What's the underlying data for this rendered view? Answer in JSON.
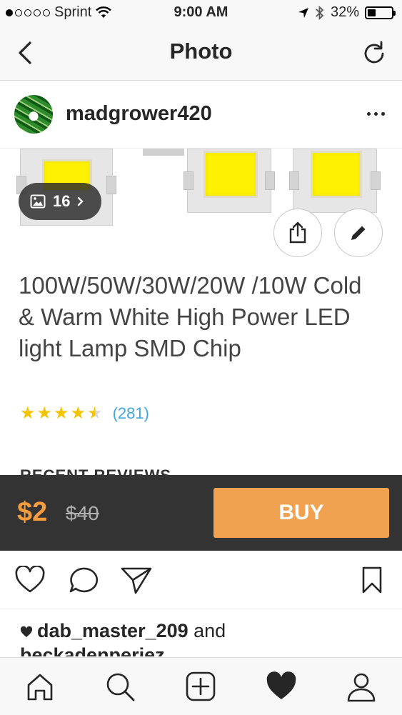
{
  "status_bar": {
    "carrier": "Sprint",
    "time": "9:00 AM",
    "battery": "32%",
    "icons": [
      "signal-dots-icon",
      "wifi-icon",
      "location-arrow-icon",
      "bluetooth-icon",
      "battery-icon"
    ]
  },
  "nav": {
    "title": "Photo",
    "icons": [
      "back-chevron-icon",
      "refresh-icon"
    ]
  },
  "post": {
    "username": "madgrower420",
    "photo_count": "16",
    "product_title": "100W/50W/30W/20W /10W Cold & Warm White High Power LED light Lamp SMD Chip",
    "rating": 4.5,
    "rating_count": "(281)",
    "recent_reviews_label": "RECENT REVIEWS"
  },
  "buy_bar": {
    "price": "$2",
    "old_price": "$40",
    "buy_label": "BUY",
    "accent": "#f39c3d",
    "button_color": "#f0a250",
    "background": "#333333"
  },
  "actions": {
    "icons": [
      "heart-icon",
      "comment-icon",
      "share-send-icon",
      "bookmark-icon"
    ],
    "liked_by": "dab_master_209",
    "liked_by_suffix": " and",
    "second_line": "beckadenperiez"
  },
  "tab_bar": {
    "icons": [
      "home-icon",
      "search-icon",
      "add-post-icon",
      "activity-heart-icon",
      "profile-icon"
    ]
  }
}
